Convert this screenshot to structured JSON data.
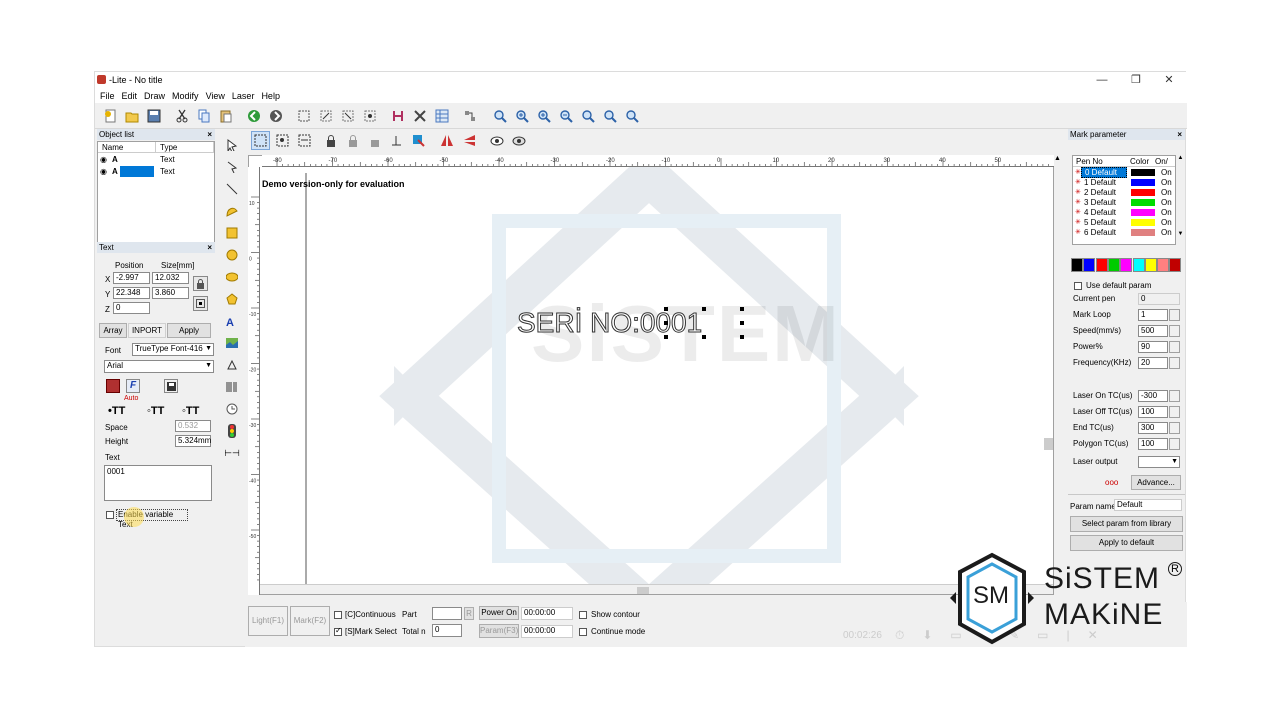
{
  "window": {
    "title": "-Lite - No title",
    "controls": {
      "minimize": "—",
      "maximize": "❐",
      "close": "✕"
    }
  },
  "menu": [
    "File",
    "Edit",
    "Draw",
    "Modify",
    "View",
    "Laser",
    "Help"
  ],
  "object_list": {
    "header": "Object list",
    "columns": [
      "Name",
      "Type"
    ],
    "rows": [
      {
        "name": "A",
        "type": "Text"
      },
      {
        "name": "A",
        "type": "Text"
      }
    ]
  },
  "text_panel": {
    "header": "Text",
    "position_label": "Position",
    "size_label": "Size[mm]",
    "x_label": "X",
    "x_pos": "-2.997",
    "x_size": "12.032",
    "y_label": "Y",
    "y_pos": "22.348",
    "y_size": "3.860",
    "z_label": "Z",
    "z_pos": "0",
    "array_btn": "Array",
    "inport_btn": "INPORT",
    "apply_btn": "Apply",
    "font_label": "Font",
    "font_type": "TrueType Font-416",
    "font_name": "Arial",
    "auto_label": "Auto",
    "space_label": "Space",
    "space_value": "0.532",
    "height_label": "Height",
    "height_value": "5.324mm",
    "text_label": "Text",
    "text_value": "0001",
    "enable_variable": "Enable variable Text"
  },
  "canvas": {
    "demo_notice": "Demo version-only for evaluation",
    "text_object": "SERİ NO:0001",
    "ruler_top": [
      "-80",
      "-70",
      "-60",
      "-50",
      "-40",
      "-30",
      "-20",
      "-10",
      "0",
      "10",
      "20",
      "30",
      "40",
      "50"
    ],
    "ruler_left": [
      "10",
      "0",
      "-10",
      "-20",
      "-30",
      "-40",
      "-50"
    ]
  },
  "mark_param": {
    "header": "Mark parameter",
    "columns": [
      "Pen No",
      "Color",
      "On/"
    ],
    "pens": [
      {
        "label": "0 Default",
        "color": "#000000",
        "state": "On"
      },
      {
        "label": "1 Default",
        "color": "#0000ff",
        "state": "On"
      },
      {
        "label": "2 Default",
        "color": "#ff0000",
        "state": "On"
      },
      {
        "label": "3 Default",
        "color": "#00dd00",
        "state": "On"
      },
      {
        "label": "4 Default",
        "color": "#ff00ff",
        "state": "On"
      },
      {
        "label": "5 Default",
        "color": "#ffff00",
        "state": "On"
      },
      {
        "label": "6 Default",
        "color": "#e08080",
        "state": "On"
      }
    ],
    "palette": [
      "#000000",
      "#0000ff",
      "#ff0000",
      "#00cc00",
      "#ff00ff",
      "#00ffff",
      "#ffff00",
      "#ff8080",
      "#c00000"
    ],
    "use_default": "Use default param",
    "current_pen_label": "Current pen",
    "current_pen": "0",
    "mark_loop_label": "Mark Loop",
    "mark_loop": "1",
    "speed_label": "Speed(mm/s)",
    "speed": "500",
    "power_label": "Power%",
    "power": "90",
    "freq_label": "Frequency(KHz)",
    "freq": "20",
    "laser_on_label": "Laser On TC(us)",
    "laser_on": "-300",
    "laser_off_label": "Laser Off TC(us)",
    "laser_off": "100",
    "end_tc_label": "End TC(us)",
    "end_tc": "300",
    "polygon_label": "Polygon TC(us)",
    "polygon": "100",
    "laser_output_label": "Laser output",
    "advance_btn": "Advance...",
    "param_name_label": "Param name",
    "param_name": "Default",
    "select_param_btn": "Select param from library",
    "apply_default_btn": "Apply to default"
  },
  "bottom": {
    "light_btn": "Light(F1)",
    "mark_btn": "Mark(F2)",
    "continuous": "[C]Continuous",
    "part_label": "Part",
    "r_btn": "R",
    "mark_select": "[S]Mark Select",
    "total_label": "Total n",
    "total_value": "0",
    "power_on_label": "Power On",
    "power_on_time": "00:00:00",
    "param_btn": "Param(F3)",
    "param_time": "00:00:00",
    "show_contour": "Show contour",
    "continue_mode": "Continue mode",
    "elapsed": "00:02:26"
  },
  "watermark": {
    "logo_line1": "SiSTEM",
    "logo_line2": "MAKiNE",
    "badge": "SM",
    "reg": "R"
  }
}
